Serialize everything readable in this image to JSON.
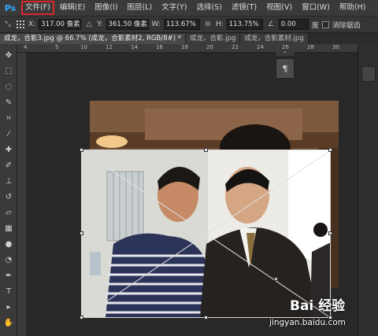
{
  "app": {
    "logo": "Ps"
  },
  "menu": [
    {
      "label": "文件(F)"
    },
    {
      "label": "编辑(E)"
    },
    {
      "label": "图像(I)"
    },
    {
      "label": "图层(L)"
    },
    {
      "label": "文字(Y)"
    },
    {
      "label": "选择(S)"
    },
    {
      "label": "滤镜(T)"
    },
    {
      "label": "视图(V)"
    },
    {
      "label": "窗口(W)"
    },
    {
      "label": "帮助(H)"
    }
  ],
  "options": {
    "x_label": "X:",
    "x_value": "317.00 像素",
    "y_label": "Y:",
    "y_value": "361.50 像素",
    "w_label": "W:",
    "w_value": "113.67%",
    "h_label": "H:",
    "h_value": "113.75%",
    "angle_value": "0.00",
    "angle_unit": "度",
    "antialias_label": "消除锯齿"
  },
  "tabs": [
    {
      "label": "成龙，合影3.jpg @ 66.7% (成龙，合影素材2, RGB/8#) *",
      "active": true
    },
    {
      "label": "成龙，合影.jpg",
      "active": false
    },
    {
      "label": "成龙，合影素材.jpg",
      "active": false
    }
  ],
  "ruler": {
    "ticks": [
      "4",
      "5",
      "10",
      "12",
      "14",
      "16",
      "18",
      "20",
      "22",
      "24",
      "26",
      "28",
      "30"
    ]
  },
  "panel": {
    "icon_glyph": "¶"
  },
  "watermark": {
    "logo": "Bai 经验",
    "url": "jingyan.baidu.com"
  },
  "colors": {
    "menubar": "#3a3a3a",
    "selected_outline": "#d8262a",
    "ps_blue": "#31a8ff"
  }
}
